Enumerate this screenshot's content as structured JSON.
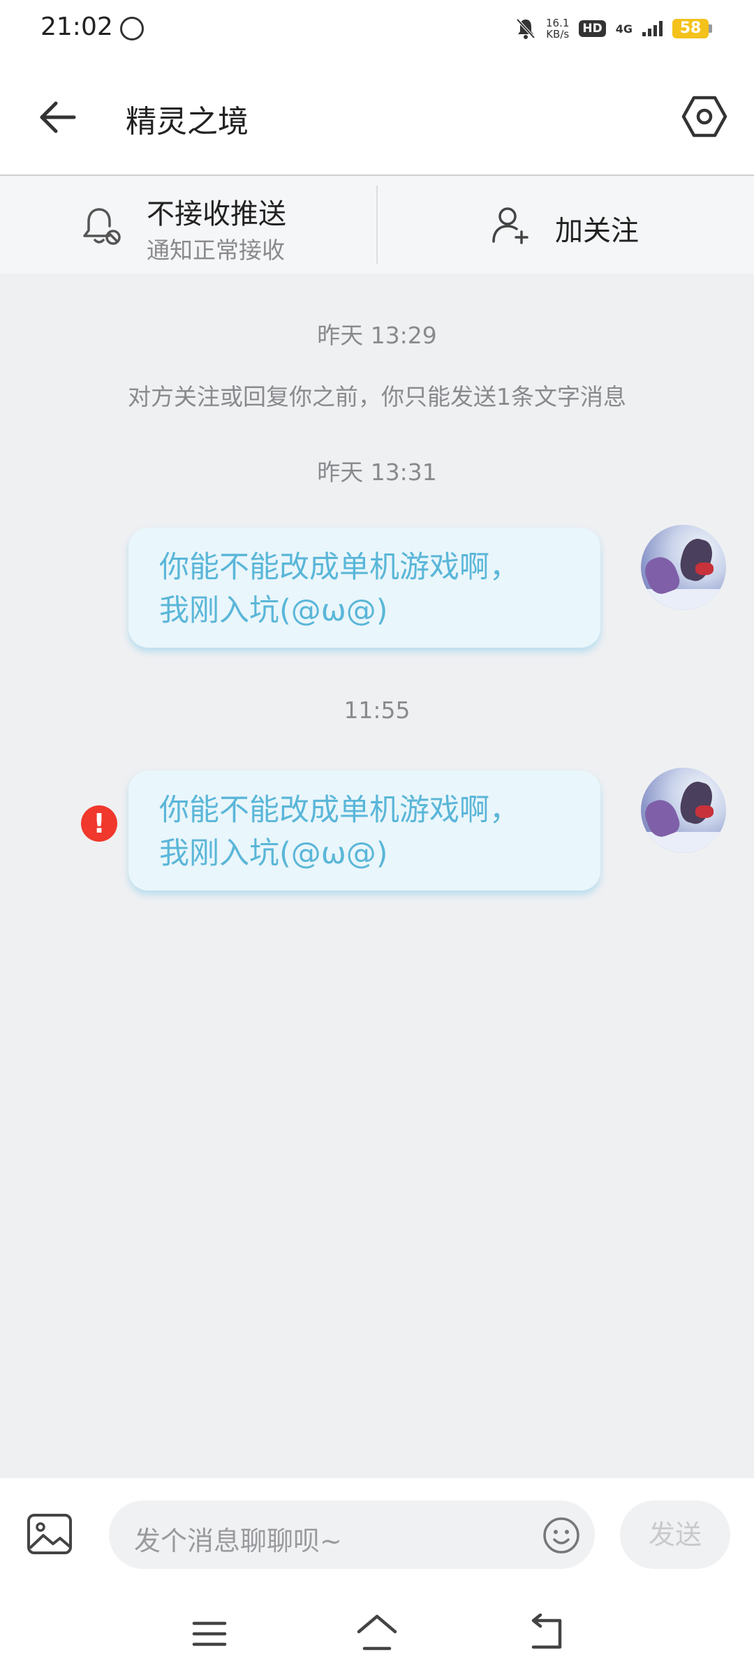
{
  "status_bar": {
    "time": "21:02",
    "speed_value": "16.1",
    "speed_unit": "KB/s",
    "hd": "HD",
    "network": "4G",
    "battery": "58",
    "icons": [
      "app-notification-icon",
      "mute-icon",
      "signal-icon",
      "battery-icon"
    ]
  },
  "header": {
    "title": "精灵之境",
    "back_icon": "back-arrow-icon",
    "settings_icon": "settings-hexagon-icon"
  },
  "actions": {
    "push_title": "不接收推送",
    "push_subtitle": "通知正常接收",
    "follow_label": "加关注"
  },
  "chat": {
    "timestamp_1": "昨天 13:29",
    "notice": "对方关注或回复你之前，你只能发送1条文字消息",
    "timestamp_2": "昨天 13:31",
    "timestamp_3": "11:55",
    "messages": [
      {
        "line1": "你能不能改成单机游戏啊，",
        "line2": "我刚入坑(@ω@)",
        "failed": false
      },
      {
        "line1": "你能不能改成单机游戏啊，",
        "line2": "我刚入坑(@ω@)",
        "failed": true
      }
    ],
    "error_mark": "!"
  },
  "input_bar": {
    "placeholder": "发个消息聊聊呗~",
    "send_label": "发送"
  },
  "colors": {
    "bubble_bg": "#e9f6fb",
    "bubble_text": "#5ab6d8",
    "error": "#f0382c",
    "background": "#eff0f2"
  }
}
